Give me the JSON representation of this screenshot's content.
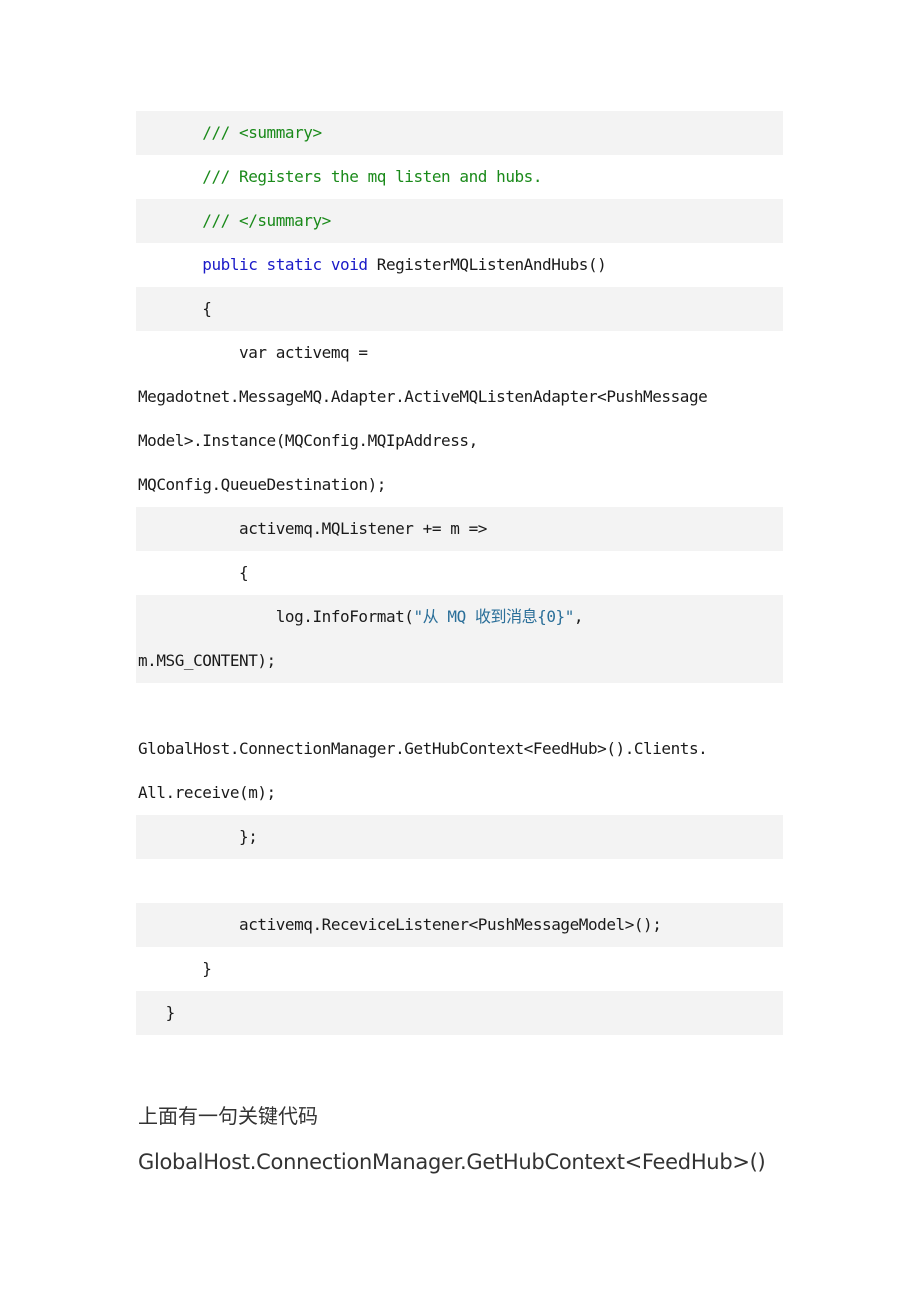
{
  "code": {
    "rows": [
      {
        "shade": "gray",
        "lines": [
          {
            "indent": "       ",
            "parts": [
              {
                "t": "/// <summary>",
                "c": "cm"
              }
            ]
          }
        ]
      },
      {
        "shade": "white",
        "lines": [
          {
            "indent": "       ",
            "parts": [
              {
                "t": "/// Registers the mq listen and hubs.",
                "c": "cm"
              }
            ]
          }
        ]
      },
      {
        "shade": "gray",
        "lines": [
          {
            "indent": "       ",
            "parts": [
              {
                "t": "/// </summary>",
                "c": "cm"
              }
            ]
          }
        ]
      },
      {
        "shade": "white",
        "lines": [
          {
            "indent": "       ",
            "parts": [
              {
                "t": "public static void",
                "c": "kw"
              },
              {
                "t": " RegisterMQListenAndHubs()",
                "c": ""
              }
            ]
          }
        ]
      },
      {
        "shade": "gray",
        "lines": [
          {
            "indent": "       ",
            "parts": [
              {
                "t": "{",
                "c": ""
              }
            ]
          }
        ]
      },
      {
        "shade": "white",
        "lines": [
          {
            "indent": "           ",
            "parts": [
              {
                "t": "var activemq =",
                "c": ""
              }
            ]
          },
          {
            "indent": "",
            "parts": [
              {
                "t": "Megadotnet.MessageMQ.Adapter.ActiveMQListenAdapter<PushMessage",
                "c": ""
              }
            ]
          },
          {
            "indent": "",
            "parts": [
              {
                "t": "Model>.Instance(MQConfig.MQIpAddress,",
                "c": ""
              }
            ]
          },
          {
            "indent": "",
            "parts": [
              {
                "t": "MQConfig.QueueDestination);",
                "c": ""
              }
            ]
          }
        ]
      },
      {
        "shade": "gray",
        "lines": [
          {
            "indent": "           ",
            "parts": [
              {
                "t": "activemq.MQListener += m =>",
                "c": ""
              }
            ]
          }
        ]
      },
      {
        "shade": "white",
        "lines": [
          {
            "indent": "           ",
            "parts": [
              {
                "t": "{",
                "c": ""
              }
            ]
          }
        ]
      },
      {
        "shade": "gray",
        "lines": [
          {
            "indent": "               ",
            "parts": [
              {
                "t": "log.InfoFormat(",
                "c": ""
              },
              {
                "t": "\"从 MQ 收到消息{0}\"",
                "c": "str"
              },
              {
                "t": ",",
                "c": ""
              }
            ]
          },
          {
            "indent": "",
            "parts": [
              {
                "t": "m.MSG_CONTENT);",
                "c": ""
              }
            ]
          }
        ]
      },
      {
        "shade": "white",
        "lines": [
          {
            "indent": "",
            "parts": [
              {
                "t": "",
                "c": ""
              }
            ]
          },
          {
            "indent": "",
            "parts": [
              {
                "t": "GlobalHost.ConnectionManager.GetHubContext<FeedHub>().Clients.",
                "c": ""
              }
            ]
          },
          {
            "indent": "",
            "parts": [
              {
                "t": "All.receive(m);",
                "c": ""
              }
            ]
          }
        ]
      },
      {
        "shade": "gray",
        "lines": [
          {
            "indent": "           ",
            "parts": [
              {
                "t": "};",
                "c": ""
              }
            ]
          }
        ]
      },
      {
        "shade": "white",
        "lines": [
          {
            "indent": "",
            "parts": [
              {
                "t": "",
                "c": ""
              }
            ]
          }
        ]
      },
      {
        "shade": "gray",
        "lines": [
          {
            "indent": "           ",
            "parts": [
              {
                "t": "activemq.ReceviceListener<PushMessageModel>();",
                "c": ""
              }
            ]
          }
        ]
      },
      {
        "shade": "white",
        "lines": [
          {
            "indent": "       ",
            "parts": [
              {
                "t": "}",
                "c": ""
              }
            ]
          }
        ]
      },
      {
        "shade": "gray",
        "lines": [
          {
            "indent": "   ",
            "parts": [
              {
                "t": "}",
                "c": ""
              }
            ]
          }
        ]
      }
    ]
  },
  "prose": {
    "intro": "上面有一句关键代码",
    "key_code": "GlobalHost.ConnectionManager.GetHubContext<FeedHub>()"
  }
}
